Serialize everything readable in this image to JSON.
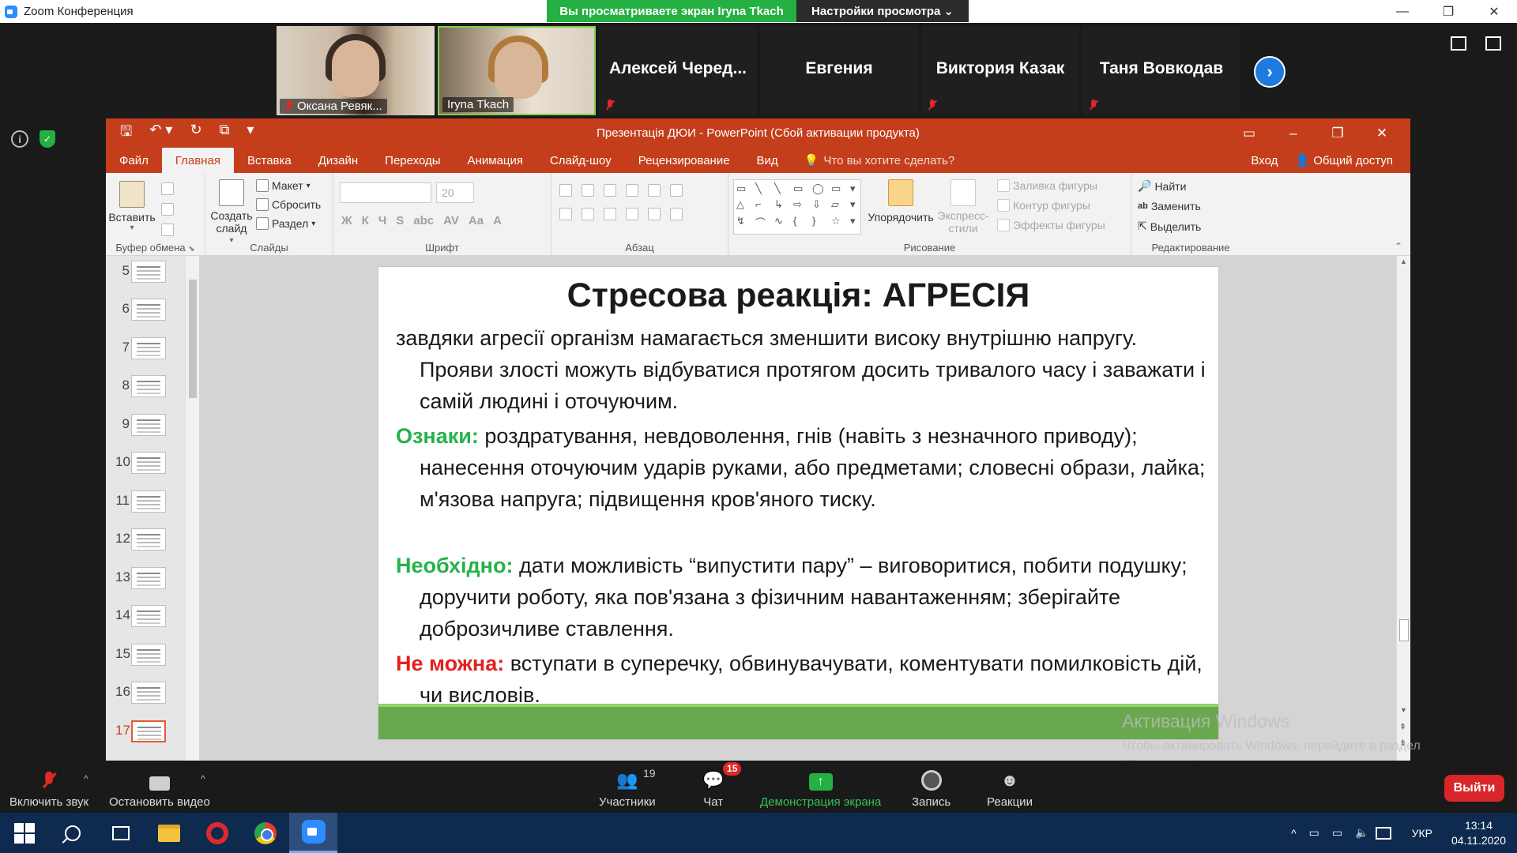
{
  "zoom": {
    "window_title": "Zoom Конференция",
    "share_banner": "Вы просматриваете экран Iryna Tkach",
    "view_settings": "Настройки просмотра",
    "view_settings_chevron": "⌄",
    "participants": [
      {
        "name": "Оксана Ревяк...",
        "video": true,
        "muted": true
      },
      {
        "name": "Iryna Tkach",
        "video": true,
        "muted": false
      },
      {
        "name": "Алексей  Черед...",
        "video": false,
        "muted": true
      },
      {
        "name": "Евгения",
        "video": false,
        "muted": false
      },
      {
        "name": "Виктория Казак",
        "video": false,
        "muted": true
      },
      {
        "name": "Таня Вовкодав",
        "video": false,
        "muted": true
      }
    ],
    "next_arrow": "›",
    "info_glyph": "i",
    "shield_glyph": "✓",
    "toolbar": {
      "unmute": "Включить звук",
      "stop_video": "Остановить видео",
      "participants": "Участники",
      "participants_count": "19",
      "chat": "Чат",
      "chat_badge": "15",
      "share": "Демонстрация экрана",
      "share_arrow": "↑",
      "record": "Запись",
      "reactions": "Реакции",
      "reactions_glyph": "☻",
      "caret": "^",
      "leave": "Выйти"
    }
  },
  "ppt": {
    "title": "Презентація ДЮИ - PowerPoint (Сбой активации продукта)",
    "qat": [
      "🖫",
      "↶ ▾",
      "↻",
      "⧉",
      "▾"
    ],
    "window_controls": [
      "▭",
      "–",
      "❐",
      "✕"
    ],
    "tabs": [
      "Файл",
      "Главная",
      "Вставка",
      "Дизайн",
      "Переходы",
      "Анимация",
      "Слайд-шоу",
      "Рецензирование",
      "Вид"
    ],
    "active_tab": "Главная",
    "tell_me": "Что вы хотите сделать?",
    "tell_me_glyph": "💡",
    "signin": "Вход",
    "share": "Общий доступ",
    "share_glyph": "👤",
    "ribbon": {
      "clipboard": {
        "label": "Буфер обмена",
        "paste": "Вставить",
        "paste_caret": "▾",
        "launcher": "⬊"
      },
      "slides": {
        "label": "Слайды",
        "new_slide": "Создать слайд",
        "new_slide_caret": "▾",
        "layout": "Макет",
        "reset": "Сбросить",
        "section": "Раздел",
        "dropdown_caret": "▾"
      },
      "font": {
        "label": "Шрифт",
        "size": "20",
        "formatting_glyphs": [
          "Ж",
          "К",
          "Ч",
          "S",
          "abc",
          "AV",
          "Aa",
          "A"
        ]
      },
      "paragraph": {
        "label": "Абзац"
      },
      "drawing": {
        "label": "Рисование",
        "arrange": "Упорядочить",
        "quick_styles": "Экспресс-стили",
        "fill": "Заливка фигуры",
        "outline": "Контур фигуры",
        "effects": "Эффекты фигуры",
        "shape_glyphs": [
          "▭",
          "╲",
          "╲",
          "▭",
          "◯",
          "▭",
          "▾",
          "△",
          "⌐",
          "↳",
          "⇨",
          "⇩",
          "▱",
          "▾",
          "↯",
          "⌒",
          "∿",
          "{",
          "}",
          "☆",
          "▾"
        ]
      },
      "editing": {
        "label": "Редактирование",
        "find": "Найти",
        "replace": "Заменить",
        "select": "Выделить",
        "find_glyph": "🔎",
        "replace_glyph": "ab",
        "select_glyph": "⇱"
      },
      "collapse_glyph": "⌃"
    },
    "thumbnails": [
      "5",
      "6",
      "7",
      "8",
      "9",
      "10",
      "11",
      "12",
      "13",
      "14",
      "15",
      "16",
      "17"
    ],
    "active_thumbnail": "17",
    "scroll_glyphs": {
      "up": "▲",
      "down": "▼",
      "page_up": "⇞",
      "page_down": "⇟"
    },
    "slide": {
      "title": "Стресова реакція: АГРЕСІЯ",
      "p1": "завдяки агресії організм намагається зменшити високу внутрішню напругу. Прояви злості можуть відбуватися протягом досить тривалого часу і заважати і самій людині і оточуючим.",
      "signs_label": "Ознаки:",
      "signs_text": " роздратування, невдоволення, гнів (навіть з незначного приводу); нанесення оточуючим ударів руками, або предметами; словесні образи, лайка; м'язова напруга; підвищення кров'яного тиску.",
      "needed_label": "Необхідно:",
      "needed_text": " дати можливість “випустити пару” – виговоритися, побити подушку; доручити роботу, яка пов'язана з фізичним навантаженням; зберігайте доброзичливе ставлення.",
      "forbidden_label": "Не можна:",
      "forbidden_text": " вступати в суперечку, обвинувачувати, коментувати помилковість дій, чи висловів."
    },
    "activation_title": "Активация Windows",
    "activation_text": "Чтобы активировать Windows, перейдите в раздел \"Параметры\"."
  },
  "taskbar": {
    "tray_caret": "^",
    "tray_icons": [
      "▭",
      "▭",
      "🔈"
    ],
    "lang": "УКР",
    "time": "13:14",
    "date": "04.11.2020"
  }
}
